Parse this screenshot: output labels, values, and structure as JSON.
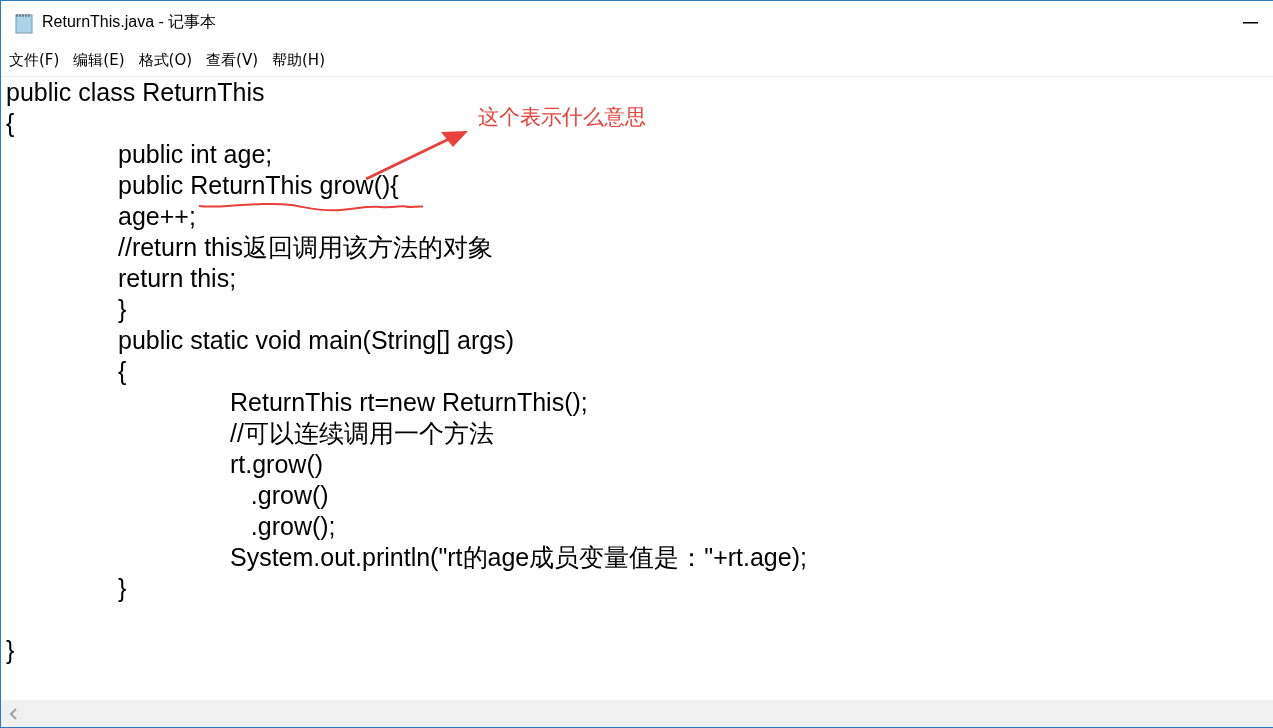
{
  "window": {
    "title": "ReturnThis.java - 记事本"
  },
  "menu": [
    {
      "label": "文件(F)"
    },
    {
      "label": "编辑(E)"
    },
    {
      "label": "格式(O)"
    },
    {
      "label": "查看(V)"
    },
    {
      "label": "帮助(H)"
    }
  ],
  "editor": {
    "lines": [
      {
        "kind": "code",
        "text": "public class ReturnThis"
      },
      {
        "kind": "code",
        "text": "{"
      },
      {
        "kind": "code",
        "text": "\tpublic int age;"
      },
      {
        "kind": "code",
        "text": "\tpublic ReturnThis grow(){"
      },
      {
        "kind": "code",
        "text": "\tage++;"
      },
      {
        "kind": "code",
        "text": "\t//return this返回调用该方法的对象"
      },
      {
        "kind": "code",
        "text": "\treturn this;"
      },
      {
        "kind": "code",
        "text": "\t}"
      },
      {
        "kind": "code",
        "text": "\tpublic static void main(String[] args)"
      },
      {
        "kind": "code",
        "text": "\t{"
      },
      {
        "kind": "code",
        "text": "\t\tReturnThis rt=new ReturnThis();"
      },
      {
        "kind": "code",
        "text": "\t\t//可以连续调用一个方法"
      },
      {
        "kind": "code",
        "text": "\t\trt.grow()"
      },
      {
        "kind": "code",
        "text": "\t\t   .grow()"
      },
      {
        "kind": "code",
        "text": "\t\t   .grow();"
      },
      {
        "kind": "code",
        "text": "\t\tSystem.out.println(\"rt的age成员变量值是：\"+rt.age);"
      },
      {
        "kind": "code",
        "text": "\t}"
      },
      {
        "kind": "blank"
      },
      {
        "kind": "code",
        "text": "}"
      }
    ]
  },
  "annotation": {
    "text": "这个表示什么意思"
  }
}
